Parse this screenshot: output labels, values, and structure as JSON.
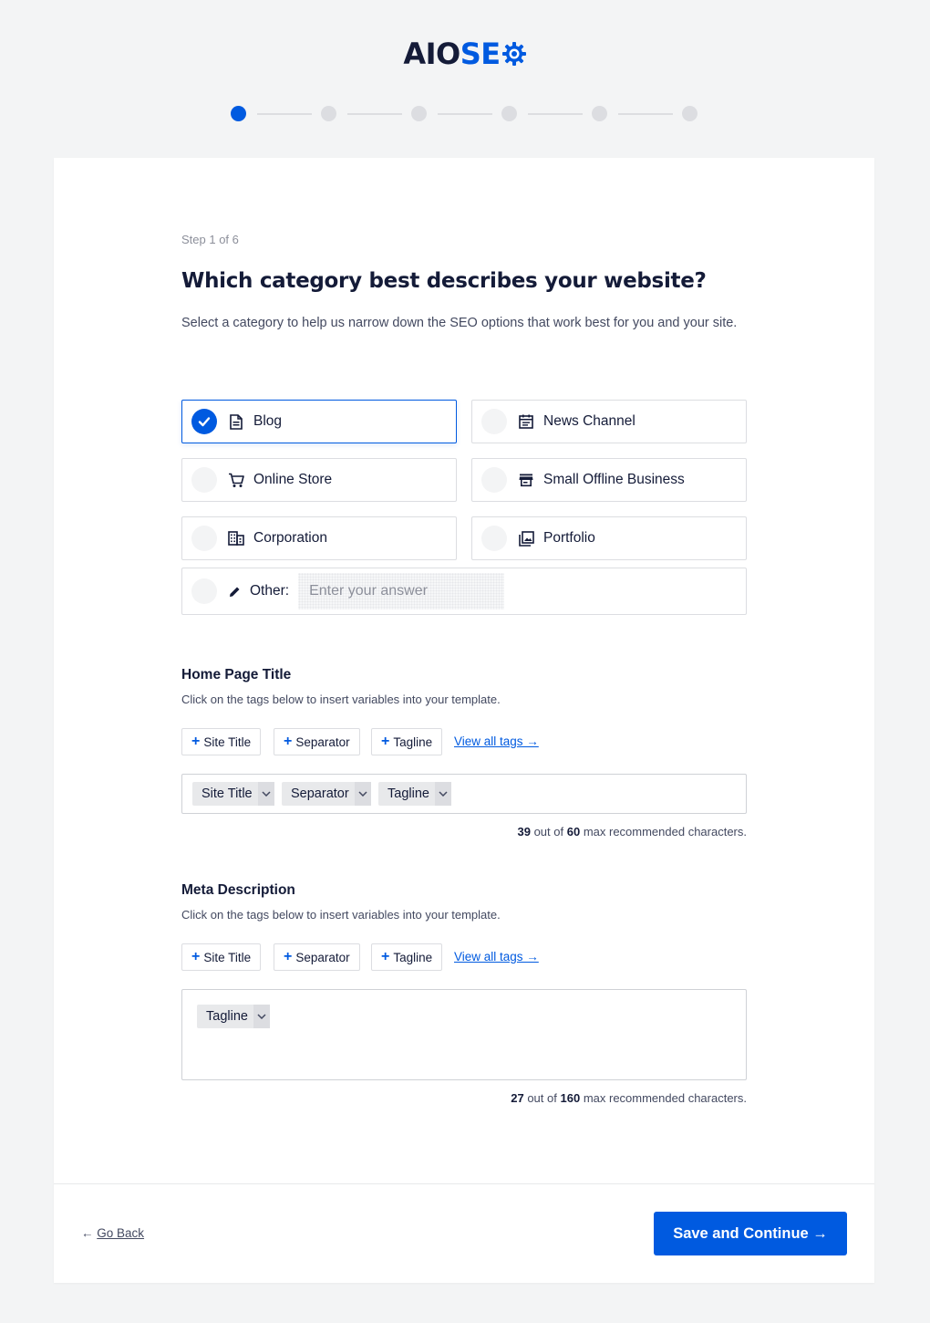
{
  "brand": {
    "part1": "AIO",
    "part2": "SE",
    "primary_color": "#005ae0",
    "dark_color": "#141b38"
  },
  "stepper": {
    "total": 6,
    "current": 1
  },
  "wizard": {
    "step_label": "Step 1 of 6",
    "heading": "Which category best describes your website?",
    "description": "Select a category to help us narrow down the SEO options that work best for you and your site."
  },
  "categories": [
    {
      "label": "Blog",
      "icon": "document-icon",
      "selected": true
    },
    {
      "label": "News Channel",
      "icon": "newspaper-icon",
      "selected": false
    },
    {
      "label": "Online Store",
      "icon": "cart-icon",
      "selected": false
    },
    {
      "label": "Small Offline Business",
      "icon": "storefront-icon",
      "selected": false
    },
    {
      "label": "Corporation",
      "icon": "building-icon",
      "selected": false
    },
    {
      "label": "Portfolio",
      "icon": "gallery-icon",
      "selected": false
    }
  ],
  "other": {
    "label": "Other:",
    "placeholder": "Enter your answer",
    "value": ""
  },
  "home_title": {
    "title": "Home Page Title",
    "subtitle": "Click on the tags below to insert variables into your template.",
    "tags": [
      "Site Title",
      "Separator",
      "Tagline"
    ],
    "view_all": "View all tags →",
    "chips": [
      "Site Title",
      "Separator",
      "Tagline"
    ],
    "count": "39",
    "max": "60",
    "counter_suffix": "max recommended characters.",
    "counter_mid": "out of"
  },
  "meta_desc": {
    "title": "Meta Description",
    "subtitle": "Click on the tags below to insert variables into your template.",
    "tags": [
      "Site Title",
      "Separator",
      "Tagline"
    ],
    "view_all": "View all tags →",
    "chips": [
      "Tagline"
    ],
    "count": "27",
    "max": "160",
    "counter_suffix": "max recommended characters.",
    "counter_mid": "out of"
  },
  "footer": {
    "back_arrow": "←",
    "back_label": "Go Back",
    "save_label": "Save and Continue →"
  }
}
